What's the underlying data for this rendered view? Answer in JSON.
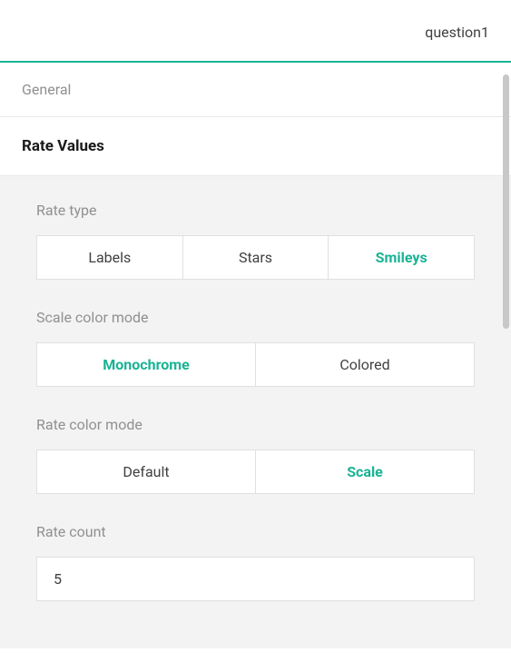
{
  "header": {
    "title": "question1"
  },
  "tabs": {
    "general": "General",
    "rateValues": "Rate Values"
  },
  "fields": {
    "rateType": {
      "label": "Rate type",
      "options": [
        "Labels",
        "Stars",
        "Smileys"
      ],
      "selected": "Smileys"
    },
    "scaleColorMode": {
      "label": "Scale color mode",
      "options": [
        "Monochrome",
        "Colored"
      ],
      "selected": "Monochrome"
    },
    "rateColorMode": {
      "label": "Rate color mode",
      "options": [
        "Default",
        "Scale"
      ],
      "selected": "Scale"
    },
    "rateCount": {
      "label": "Rate count",
      "value": "5"
    }
  }
}
